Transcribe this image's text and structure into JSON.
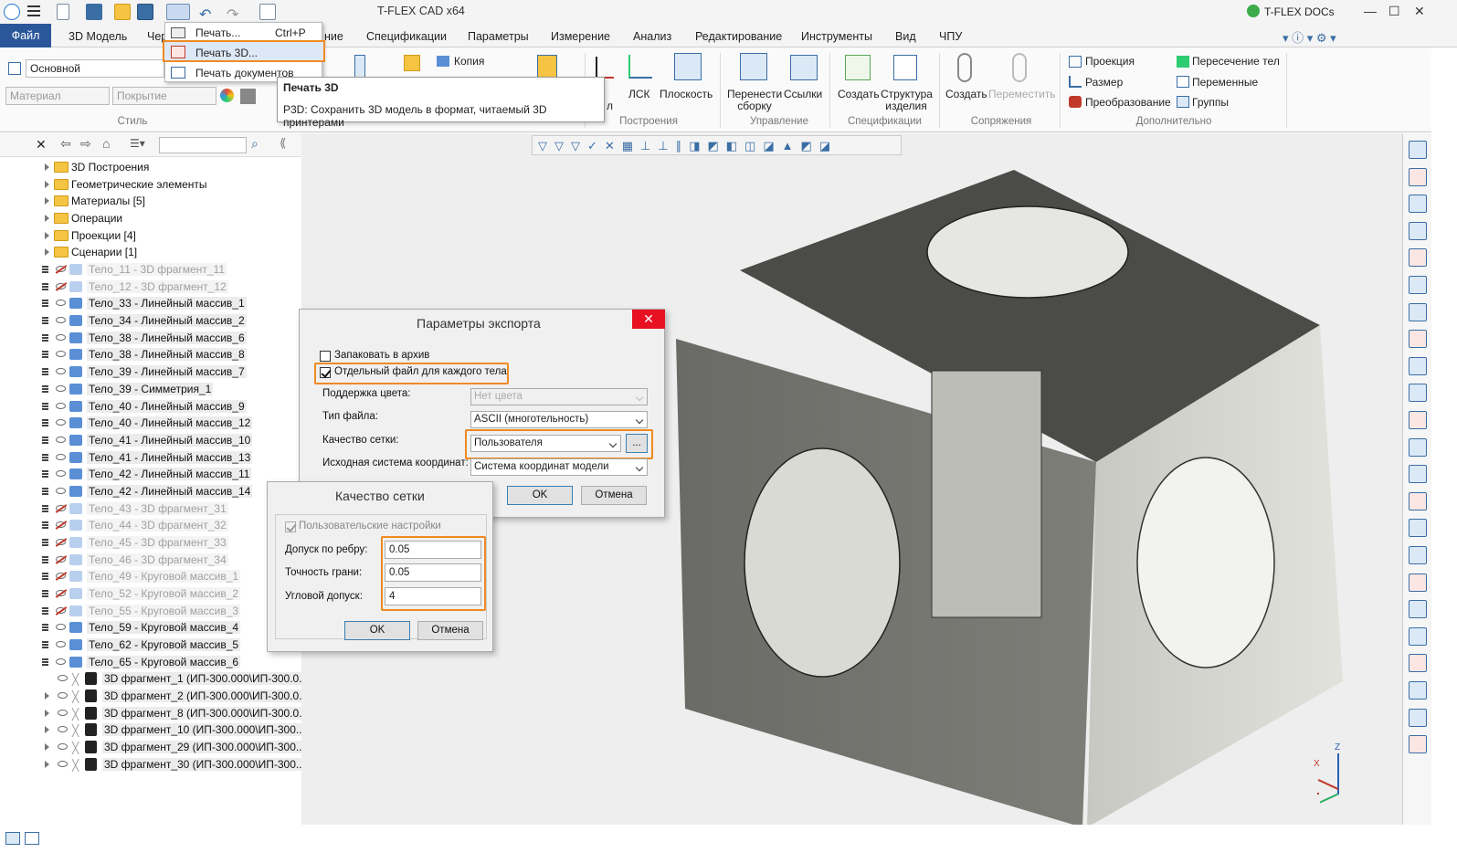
{
  "window": {
    "title": "T-FLEX CAD x64",
    "docs_label": "T-FLEX DOCs"
  },
  "tabs": {
    "file": "Файл",
    "model3d": "3D Модель",
    "drawing": "Чер",
    "hidden": "ние",
    "specs": "Спецификации",
    "params": "Параметры",
    "measure": "Измерение",
    "analysis": "Анализ",
    "edit": "Редактирование",
    "tools": "Инструменты",
    "view": "Вид",
    "cnc": "ЧПУ"
  },
  "ribbon": {
    "style_combo": "Основной",
    "material_placeholder": "Материал",
    "coating_placeholder": "Покрытие",
    "style_group": "Стиль",
    "copy": "Копия",
    "operations_label": "л",
    "lsk": "ЛСК",
    "plane": "Плоскость",
    "constructions_group": "Построения",
    "transfer_assembly": "Перенести сборку",
    "links": "Ссылки",
    "control_group": "Управление",
    "create": "Создать",
    "product_structure": "Структура изделия",
    "specs_group": "Спецификации",
    "create2": "Создать",
    "move": "Переместить",
    "mates_group": "Сопряжения",
    "projection": "Проекция",
    "size": "Размер",
    "transform": "Преобразование",
    "body_intersection": "Пересечение тел",
    "variables": "Переменные",
    "groups": "Группы",
    "additional_group": "Дополнительно"
  },
  "print_menu": {
    "print": "Печать...",
    "print_shortcut": "Ctrl+P",
    "print3d": "Печать 3D...",
    "print_docs": "Печать документов"
  },
  "tooltip": {
    "title": "Печать 3D",
    "text": "P3D: Сохранить 3D модель в формат, читаемый 3D принтерами"
  },
  "tree": [
    {
      "label": "3D Построения",
      "type": "folder"
    },
    {
      "label": "Геометрические элементы",
      "type": "folder"
    },
    {
      "label": "Материалы [5]",
      "type": "folder"
    },
    {
      "label": "Операции",
      "type": "folder"
    },
    {
      "label": "Проекции [4]",
      "type": "folder"
    },
    {
      "label": "Сценарии [1]",
      "type": "folder"
    },
    {
      "label": "Тело_11 - 3D фрагмент_11",
      "type": "body",
      "dim": true
    },
    {
      "label": "Тело_12 - 3D фрагмент_12",
      "type": "body",
      "dim": true
    },
    {
      "label": "Тело_33 - Линейный массив_1",
      "type": "body"
    },
    {
      "label": "Тело_34 - Линейный массив_2",
      "type": "body"
    },
    {
      "label": "Тело_38 - Линейный массив_6",
      "type": "body"
    },
    {
      "label": "Тело_38 - Линейный массив_8",
      "type": "body"
    },
    {
      "label": "Тело_39 - Линейный массив_7",
      "type": "body"
    },
    {
      "label": "Тело_39 - Симметрия_1",
      "type": "body"
    },
    {
      "label": "Тело_40 - Линейный массив_9",
      "type": "body"
    },
    {
      "label": "Тело_40 - Линейный массив_12",
      "type": "body"
    },
    {
      "label": "Тело_41 - Линейный массив_10",
      "type": "body"
    },
    {
      "label": "Тело_41 - Линейный массив_13",
      "type": "body"
    },
    {
      "label": "Тело_42 - Линейный массив_11",
      "type": "body"
    },
    {
      "label": "Тело_42 - Линейный массив_14",
      "type": "body"
    },
    {
      "label": "Тело_43 - 3D фрагмент_31",
      "type": "body",
      "dim": true
    },
    {
      "label": "Тело_44 - 3D фрагмент_32",
      "type": "body",
      "dim": true
    },
    {
      "label": "Тело_45 - 3D фрагмент_33",
      "type": "body",
      "dim": true
    },
    {
      "label": "Тело_46 - 3D фрагмент_34",
      "type": "body",
      "dim": true
    },
    {
      "label": "Тело_49 - Круговой массив_1",
      "type": "body",
      "dim": true
    },
    {
      "label": "Тело_52 - Круговой массив_2",
      "type": "body",
      "dim": true
    },
    {
      "label": "Тело_55 - Круговой массив_3",
      "type": "body",
      "dim": true
    },
    {
      "label": "Тело_59 - Круговой массив_4",
      "type": "body"
    },
    {
      "label": "Тело_62 - Круговой массив_5",
      "type": "body"
    },
    {
      "label": "Тело_65 - Круговой массив_6",
      "type": "body"
    },
    {
      "label": "3D фрагмент_1 (ИП-300.000\\ИП-300.0...",
      "type": "frag"
    },
    {
      "label": "3D фрагмент_2 (ИП-300.000\\ИП-300.0...",
      "type": "frag"
    },
    {
      "label": "3D фрагмент_8 (ИП-300.000\\ИП-300.0...",
      "type": "frag"
    },
    {
      "label": "3D фрагмент_10 (ИП-300.000\\ИП-300....",
      "type": "frag"
    },
    {
      "label": "3D фрагмент_29 (ИП-300.000\\ИП-300....",
      "type": "frag"
    },
    {
      "label": "3D фрагмент_30 (ИП-300.000\\ИП-300....",
      "type": "frag"
    }
  ],
  "export_dialog": {
    "title": "Параметры экспорта",
    "pack_archive": "Запаковать в архив",
    "separate_file": "Отдельный файл для каждого тела",
    "color_support": "Поддержка цвета:",
    "color_value": "Нет цвета",
    "file_type": "Тип файла:",
    "file_type_value": "ASCII (многотельность)",
    "mesh_quality": "Качество сетки:",
    "mesh_quality_value": "Пользователя",
    "ellipsis": "...",
    "coord_system": "Исходная система координат:",
    "coord_value": "Система координат модели",
    "ok": "OK",
    "cancel": "Отмена"
  },
  "mesh_dialog": {
    "title": "Качество сетки",
    "user_settings": "Пользовательские настройки",
    "edge_tol": "Допуск по ребру:",
    "edge_tol_value": "0.05",
    "face_acc": "Точность грани:",
    "face_acc_value": "0.05",
    "angle_tol": "Угловой допуск:",
    "angle_tol_value": "4",
    "ok": "OK",
    "cancel": "Отмена"
  },
  "axes": {
    "x": "X",
    "z": "Z"
  },
  "colors": {
    "accent": "#2b579a",
    "highlight": "#f08a24"
  }
}
